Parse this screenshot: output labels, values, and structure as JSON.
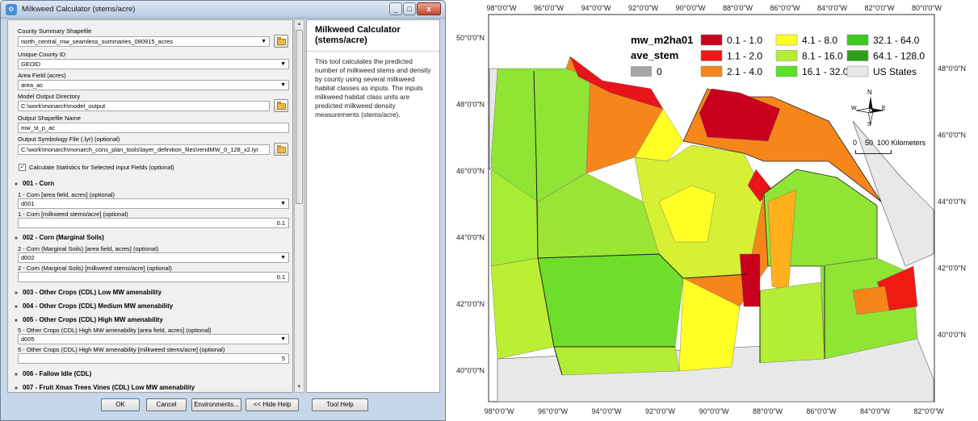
{
  "window": {
    "title": "Milkweed Calculator (stems/acre)",
    "close_glyph": "x",
    "min_glyph": "_",
    "max_glyph": "□"
  },
  "form": {
    "county_shapefile": {
      "label": "County Summary Shapefile",
      "value": "north_central_mw_seamless_summaries_090915_acres"
    },
    "unique_id": {
      "label": "Unique County ID",
      "value": "GEOID"
    },
    "area_field": {
      "label": "Area Field (acres)",
      "value": "area_ac"
    },
    "output_dir": {
      "label": "Model Output Directory",
      "value": "C:\\work\\monarch\\model_output"
    },
    "output_name": {
      "label": "Output Shapefile Name",
      "value": "mw_st_p_ac"
    },
    "symbology": {
      "label": "Output Symbology File (.lyr) (optional)",
      "value": "C:\\work\\monarch\\monarch_cons_plan_tools\\layer_definition_files\\rendMW_0_128_x2.lyr"
    },
    "calc_stats": {
      "label": "Calculate Statistics for Selected Input Fields (optional)",
      "checked": "✓"
    },
    "sections": [
      {
        "title": "001 - Corn",
        "area_label": "1 - Corn [area field, acres] (optional)",
        "area_value": "d001",
        "density_label": "1 - Corn [milkweed stems/acre] (optional)",
        "density_value": "0.1"
      },
      {
        "title": "002 - Corn (Marginal Soils)",
        "area_label": "2 - Corn (Marginal Soils) [area field, acres] (optional)",
        "area_value": "d002",
        "density_label": "2 - Corn (Marginal Soils) [milkweed stems/acre] (optional)",
        "density_value": "0.1"
      },
      {
        "title": "003 - Other Crops (CDL) Low MW amenability"
      },
      {
        "title": "004 - Other Crops (CDL) Medium MW amenability"
      },
      {
        "title": "005 - Other Crops (CDL) High MW amenability",
        "area_label": "5 - Other Crops (CDL) High MW amenability [area field, acres] (optional)",
        "area_value": "d005",
        "density_label": "5 - Other Crops (CDL) High MW amenability [milkweed stems/acre] (optional)",
        "density_value": "5"
      },
      {
        "title": "006 - Fallow Idle (CDL)"
      },
      {
        "title": "007 - Fruit Xmas Trees Vines (CDL) Low MW amenability"
      }
    ],
    "expanded_glyph": "»",
    "collapsed_glyph": "»"
  },
  "help": {
    "title": "Milkweed Calculator (stems/acre)",
    "body": "This tool calculates the predicted number of milkweed stems and density by county using several milkweed habitat classes as inputs. The inputs milkweed habitat class units are predicted milkweed density measurements (stems/acre)."
  },
  "buttons": {
    "ok": "OK",
    "cancel": "Cancel",
    "environments": "Environments...",
    "hide_help": "<< Hide Help",
    "tool_help": "Tool Help"
  },
  "map": {
    "top_ticks": [
      "98°0'0\"W",
      "96°0'0\"W",
      "94°0'0\"W",
      "92°0'0\"W",
      "90°0'0\"W",
      "88°0'0\"W",
      "86°0'0\"W",
      "84°0'0\"W",
      "82°0'0\"W",
      "80°0'0\"W"
    ],
    "bottom_ticks": [
      "98°0'0\"W",
      "96°0'0\"W",
      "94°0'0\"W",
      "92°0'0\"W",
      "90°0'0\"W",
      "88°0'0\"W",
      "86°0'0\"W",
      "84°0'0\"W",
      "82°0'0\"W"
    ],
    "left_ticks": [
      "50°0'0\"N",
      "48°0'0\"N",
      "46°0'0\"N",
      "44°0'0\"N",
      "42°0'0\"N",
      "40°0'0\"N"
    ],
    "right_ticks": [
      "48°0'0\"N",
      "46°0'0\"N",
      "44°0'0\"N",
      "42°0'0\"N",
      "40°0'0\"N"
    ],
    "legend": {
      "field1": "mw_m2ha01",
      "field2": "ave_stem",
      "classes": [
        {
          "label": "0.1 - 1.0",
          "color": "#c8001e"
        },
        {
          "label": "1.1 - 2.0",
          "color": "#f01a14"
        },
        {
          "label": "2.1 - 4.0",
          "color": "#f7861a"
        },
        {
          "label": "4.1 - 8.0",
          "color": "#ffff26"
        },
        {
          "label": "8.1 - 16.0",
          "color": "#b4ee34"
        },
        {
          "label": "16.1 - 32.0",
          "color": "#5ee02a"
        },
        {
          "label": "32.1 - 64.0",
          "color": "#3dc81e"
        },
        {
          "label": "64.1 - 128.0",
          "color": "#2f9f1a"
        }
      ],
      "zero": {
        "label": "0",
        "color": "#a6a6a6"
      },
      "states": {
        "label": "US States",
        "color": "#e8e8e8"
      }
    },
    "compass": {
      "n": "N",
      "s": "S",
      "e": "E",
      "w": "W"
    },
    "scale": {
      "label": "0    50  100 Kilometers"
    }
  }
}
